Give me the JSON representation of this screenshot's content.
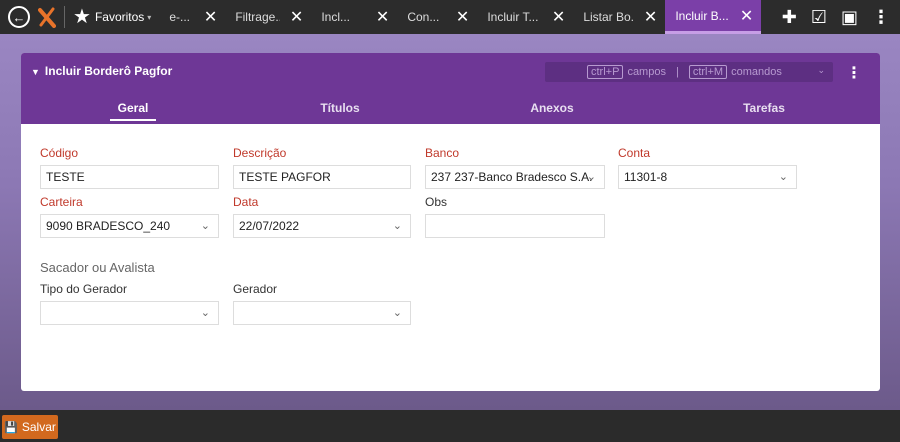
{
  "topbar": {
    "favorites_label": "Favoritos",
    "tabs": [
      {
        "label": "e-..."
      },
      {
        "label": "Filtrage..."
      },
      {
        "label": "Incl..."
      },
      {
        "label": "Con..."
      },
      {
        "label": "Incluir T..."
      },
      {
        "label": "Listar Bo..."
      },
      {
        "label": "Incluir B..."
      }
    ],
    "active_tab_index": 6
  },
  "panel": {
    "title": "Incluir Borderô Pagfor",
    "shortcuts": {
      "key1": "ctrl+P",
      "label1": "campos",
      "key2": "ctrl+M",
      "label2": "comandos"
    },
    "subtabs": [
      "Geral",
      "Títulos",
      "Anexos",
      "Tarefas"
    ]
  },
  "form": {
    "codigo": {
      "label": "Código",
      "value": "TESTE"
    },
    "descricao": {
      "label": "Descrição",
      "value": "TESTE PAGFOR"
    },
    "banco": {
      "label": "Banco",
      "value": "237 237-Banco Bradesco S.A."
    },
    "conta": {
      "label": "Conta",
      "value": "11301-8"
    },
    "carteira": {
      "label": "Carteira",
      "value": "9090 BRADESCO_240"
    },
    "data": {
      "label": "Data",
      "value": "22/07/2022"
    },
    "obs": {
      "label": "Obs",
      "value": ""
    },
    "section": "Sacador ou Avalista",
    "tipo_gerador": {
      "label": "Tipo do Gerador",
      "value": ""
    },
    "gerador": {
      "label": "Gerador",
      "value": ""
    }
  },
  "footer": {
    "save_label": "Salvar"
  },
  "colors": {
    "accent": "#6e3796",
    "required_label": "#c0392b",
    "save_button": "#d2691e"
  }
}
